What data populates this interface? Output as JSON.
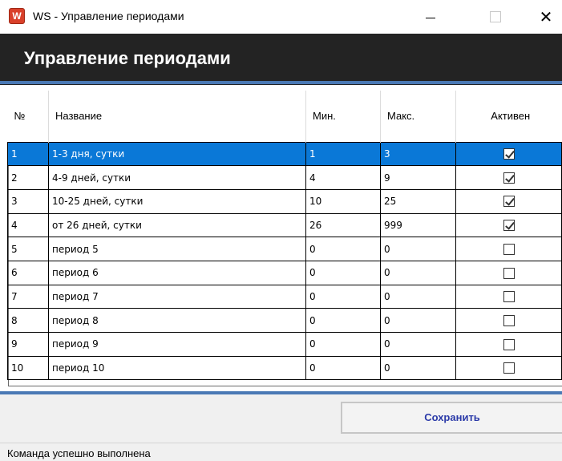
{
  "window": {
    "icon_letter": "W",
    "title": "WS - Управление периодами",
    "close_glyph": "✕"
  },
  "header": {
    "title": "Управление периодами",
    "background": "#232323",
    "accent": "#4a79b5"
  },
  "grid": {
    "columns": [
      "№",
      "Название",
      "Мин.",
      "Макс.",
      "Активен"
    ],
    "selected_row_color": "#0a78d7",
    "rows": [
      {
        "num": "1",
        "name": "1-3 дня, сутки",
        "min": "1",
        "max": "3",
        "active": true
      },
      {
        "num": "2",
        "name": "4-9 дней, сутки",
        "min": "4",
        "max": "9",
        "active": true
      },
      {
        "num": "3",
        "name": "10-25 дней, сутки",
        "min": "10",
        "max": "25",
        "active": true
      },
      {
        "num": "4",
        "name": "от 26 дней, сутки",
        "min": "26",
        "max": "999",
        "active": true
      },
      {
        "num": "5",
        "name": "период 5",
        "min": "0",
        "max": "0",
        "active": false
      },
      {
        "num": "6",
        "name": "период 6",
        "min": "0",
        "max": "0",
        "active": false
      },
      {
        "num": "7",
        "name": "период 7",
        "min": "0",
        "max": "0",
        "active": false
      },
      {
        "num": "8",
        "name": "период 8",
        "min": "0",
        "max": "0",
        "active": false
      },
      {
        "num": "9",
        "name": "период 9",
        "min": "0",
        "max": "0",
        "active": false
      },
      {
        "num": "10",
        "name": "период 10",
        "min": "0",
        "max": "0",
        "active": false
      }
    ],
    "selected_index": 0
  },
  "actions": {
    "save_label": "Сохранить"
  },
  "status_bar": {
    "text": "Команда успешно выполнена"
  }
}
